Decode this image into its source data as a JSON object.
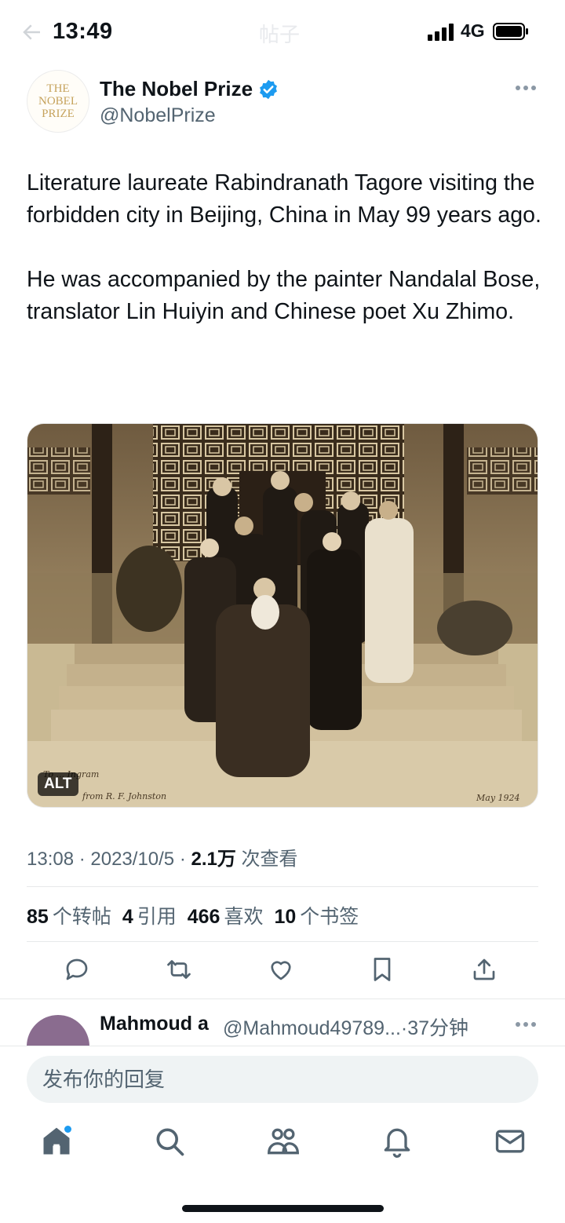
{
  "status_bar": {
    "time": "13:49",
    "network": "4G",
    "ghost_title": "帖子"
  },
  "author": {
    "name": "The Nobel Prize",
    "handle": "@NobelPrize",
    "avatar_lines": [
      "THE",
      "NOBEL",
      "PRIZE"
    ]
  },
  "tweet": {
    "paragraphs": [
      "Literature laureate Rabindranath Tagore visiting the forbidden city in Beijing, China in May 99 years ago.",
      "He was accompanied by the painter Nandalal Bose, translator Lin Huiyin and Chinese poet Xu Zhimo."
    ],
    "alt_badge": "ALT",
    "meta": {
      "time_date": "13:08 · 2023/10/5 · ",
      "views": "2.1万",
      "views_label": " 次查看"
    }
  },
  "stats": [
    {
      "count": "85",
      "label": "个转帖"
    },
    {
      "count": "4",
      "label": "引用"
    },
    {
      "count": "466",
      "label": "喜欢"
    },
    {
      "count": "10",
      "label": "个书签"
    }
  ],
  "reply_preview": {
    "name": "Mahmoud a",
    "handle_time": "@Mahmoud49789...·37分钟"
  },
  "composer": {
    "placeholder": "发布你的回复"
  },
  "icons": {
    "actions": [
      "reply-icon",
      "retweet-icon",
      "like-icon",
      "bookmark-icon",
      "share-icon"
    ],
    "nav": [
      "home-icon",
      "search-icon",
      "communities-icon",
      "notifications-icon",
      "messages-icon"
    ]
  },
  "colors": {
    "text": "#0f1419",
    "secondary": "#536471",
    "accent": "#1d9bf0",
    "sepia": "#b9a481"
  }
}
